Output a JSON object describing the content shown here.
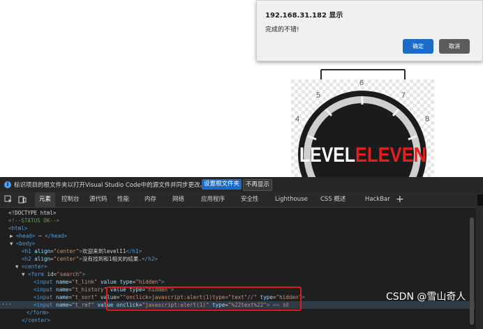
{
  "dialog": {
    "title": "192.168.31.182 显示",
    "message": "完成的不错!",
    "ok_label": "确定",
    "cancel_label": "取消"
  },
  "page_image": {
    "logo_text_left": "LEVEL",
    "logo_text_right": "ELEVEN",
    "dial_numbers": [
      "5",
      "6",
      "7",
      "4",
      "8"
    ]
  },
  "devtools": {
    "infobar": {
      "icon": "info-icon",
      "text": "标识项目的根文件夹以打开Visual Studio Code中的源文件并同步更改。",
      "primary_button": "设置根文件夹",
      "secondary_button": "不再显示"
    },
    "tabs": [
      "元素",
      "控制台",
      "源代码",
      "性能",
      "内存",
      "网络",
      "应用程序",
      "安全性",
      "Lighthouse",
      "CSS 概述",
      "HackBar"
    ],
    "active_tab": "元素",
    "code": {
      "l1": "<!DOCTYPE html>",
      "l2": "<!--STATUS OK-->",
      "l3_tag": "<html>",
      "l4_open": "<head>",
      "l4_close": "</head>",
      "l5": "<body>",
      "l6_tag": "<h1",
      "l6_attr": "align",
      "l6_val": "\"center\"",
      "l6_text": "欢迎来到level11",
      "l6_close": "</h1>",
      "l7_tag": "<h2",
      "l7_attr": "align",
      "l7_val": "\"center\"",
      "l7_text": "没有找到和1相关的结果.",
      "l7_close": "</h2>",
      "l8": "<center>",
      "l9_tag": "<form",
      "l9_attr": "id",
      "l9_val": "\"search\"",
      "l10_val_name": "\"t_link\"",
      "l10_val_type": "\"hidden\"",
      "l11_val_name": "\"t_history\"",
      "l11_val_type": "\"hidden\"",
      "l12_val_name": "\"t_sort\"",
      "l12_val": "\"\"onclick=javascript:alert(1)type=\"text\"//\"",
      "l12_val_type": "\"hidden\"",
      "l13_val_name": "\"t_ref\"",
      "l13_onclick_val": "\"javascript:alert(1)\"",
      "l13_type_val": "\"%22text%22\"",
      "l13_suffix": "== $0",
      "l14": "</form>",
      "l15": "</center>"
    }
  },
  "watermark": "CSDN @雪山奇人"
}
